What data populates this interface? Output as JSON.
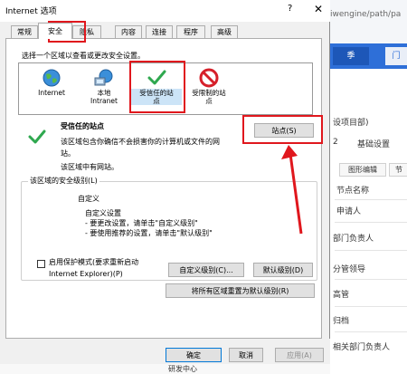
{
  "background": {
    "url_fragment": "iwengine/path/pa",
    "top_button": "季",
    "top_button2": "门",
    "item_project": "设项目部)",
    "step_number": "2",
    "step_label": "基础设置",
    "tab_graph": "图形编辑",
    "tab_other": "节",
    "col_header": "节点名称",
    "rows": [
      "申请人",
      "部门负责人",
      "分管领导",
      "高管",
      "归档",
      "相关部门负责人"
    ],
    "bottom_row": "研发中心"
  },
  "dialog": {
    "title": "Internet 选项",
    "help": "?",
    "close": "✕",
    "tabs": [
      "常规",
      "安全",
      "隐私",
      "内容",
      "连接",
      "程序",
      "高级"
    ],
    "instruction": "选择一个区域以查看或更改安全设置。",
    "zones": [
      {
        "icon": "globe-icon",
        "label": "Internet"
      },
      {
        "icon": "network-icon",
        "label": "本地\nIntranet"
      },
      {
        "icon": "checkmark-icon",
        "label": "受信任的站\n点"
      },
      {
        "icon": "restricted-icon",
        "label": "受限制的站\n点"
      }
    ],
    "selected_zone_title": "受信任的站点",
    "selected_zone_desc_1": "该区域包含你确信不会损害你的计算机或文件的网",
    "selected_zone_desc_2": "站。",
    "selected_zone_desc_3": "该区域中有网站。",
    "sites_button": "站点(S)",
    "security_level_label": "该区域的安全级别(L)",
    "custom_title": "自定义",
    "custom_line1": "自定义设置",
    "custom_line2": "- 要更改设置，请单击\"自定义级别\"",
    "custom_line3": "- 要使用推荐的设置，请单击\"默认级别\"",
    "protected_mode_line1": "启用保护模式(要求重新启动",
    "protected_mode_line2": "Internet Explorer)(P)",
    "protected_mode_checked": false,
    "custom_level_button": "自定义级别(C)...",
    "default_level_button": "默认级别(D)",
    "reset_all_button": "将所有区域重置为默认级别(R)",
    "ok_button": "确定",
    "cancel_button": "取消",
    "apply_button": "应用(A)"
  },
  "colors": {
    "annotation_red": "#e0171d",
    "selected_zone_bg": "#cce4f7",
    "default_button_border": "#0078d7"
  }
}
